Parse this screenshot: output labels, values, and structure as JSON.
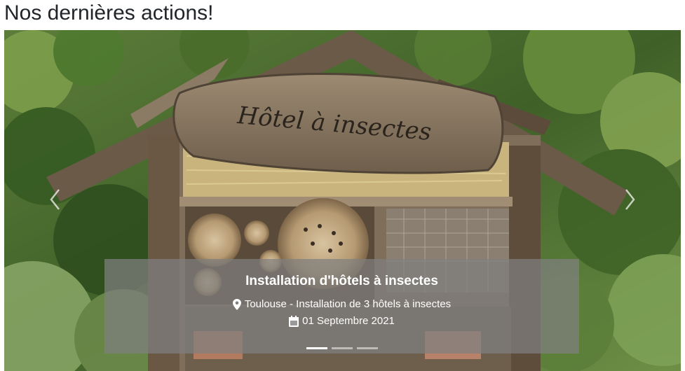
{
  "section": {
    "title": "Nos dernières actions!"
  },
  "carousel": {
    "slide": {
      "sign_text": "Hôtel à insectes",
      "caption_title": "Installation d'hôtels à insectes",
      "location_text": "Toulouse - Installation de 3 hôtels à insectes",
      "date_text": "01 Septembre 2021"
    },
    "indicators": [
      {
        "active": true
      },
      {
        "active": false
      },
      {
        "active": false
      }
    ],
    "controls": {
      "prev_icon": "chevron-left-icon",
      "next_icon": "chevron-right-icon"
    },
    "icons": {
      "location": "map-marker-icon",
      "date": "calendar-icon"
    },
    "colors": {
      "caption_bg": "#808080",
      "caption_text": "#ffffff",
      "title_text": "#212529"
    }
  }
}
